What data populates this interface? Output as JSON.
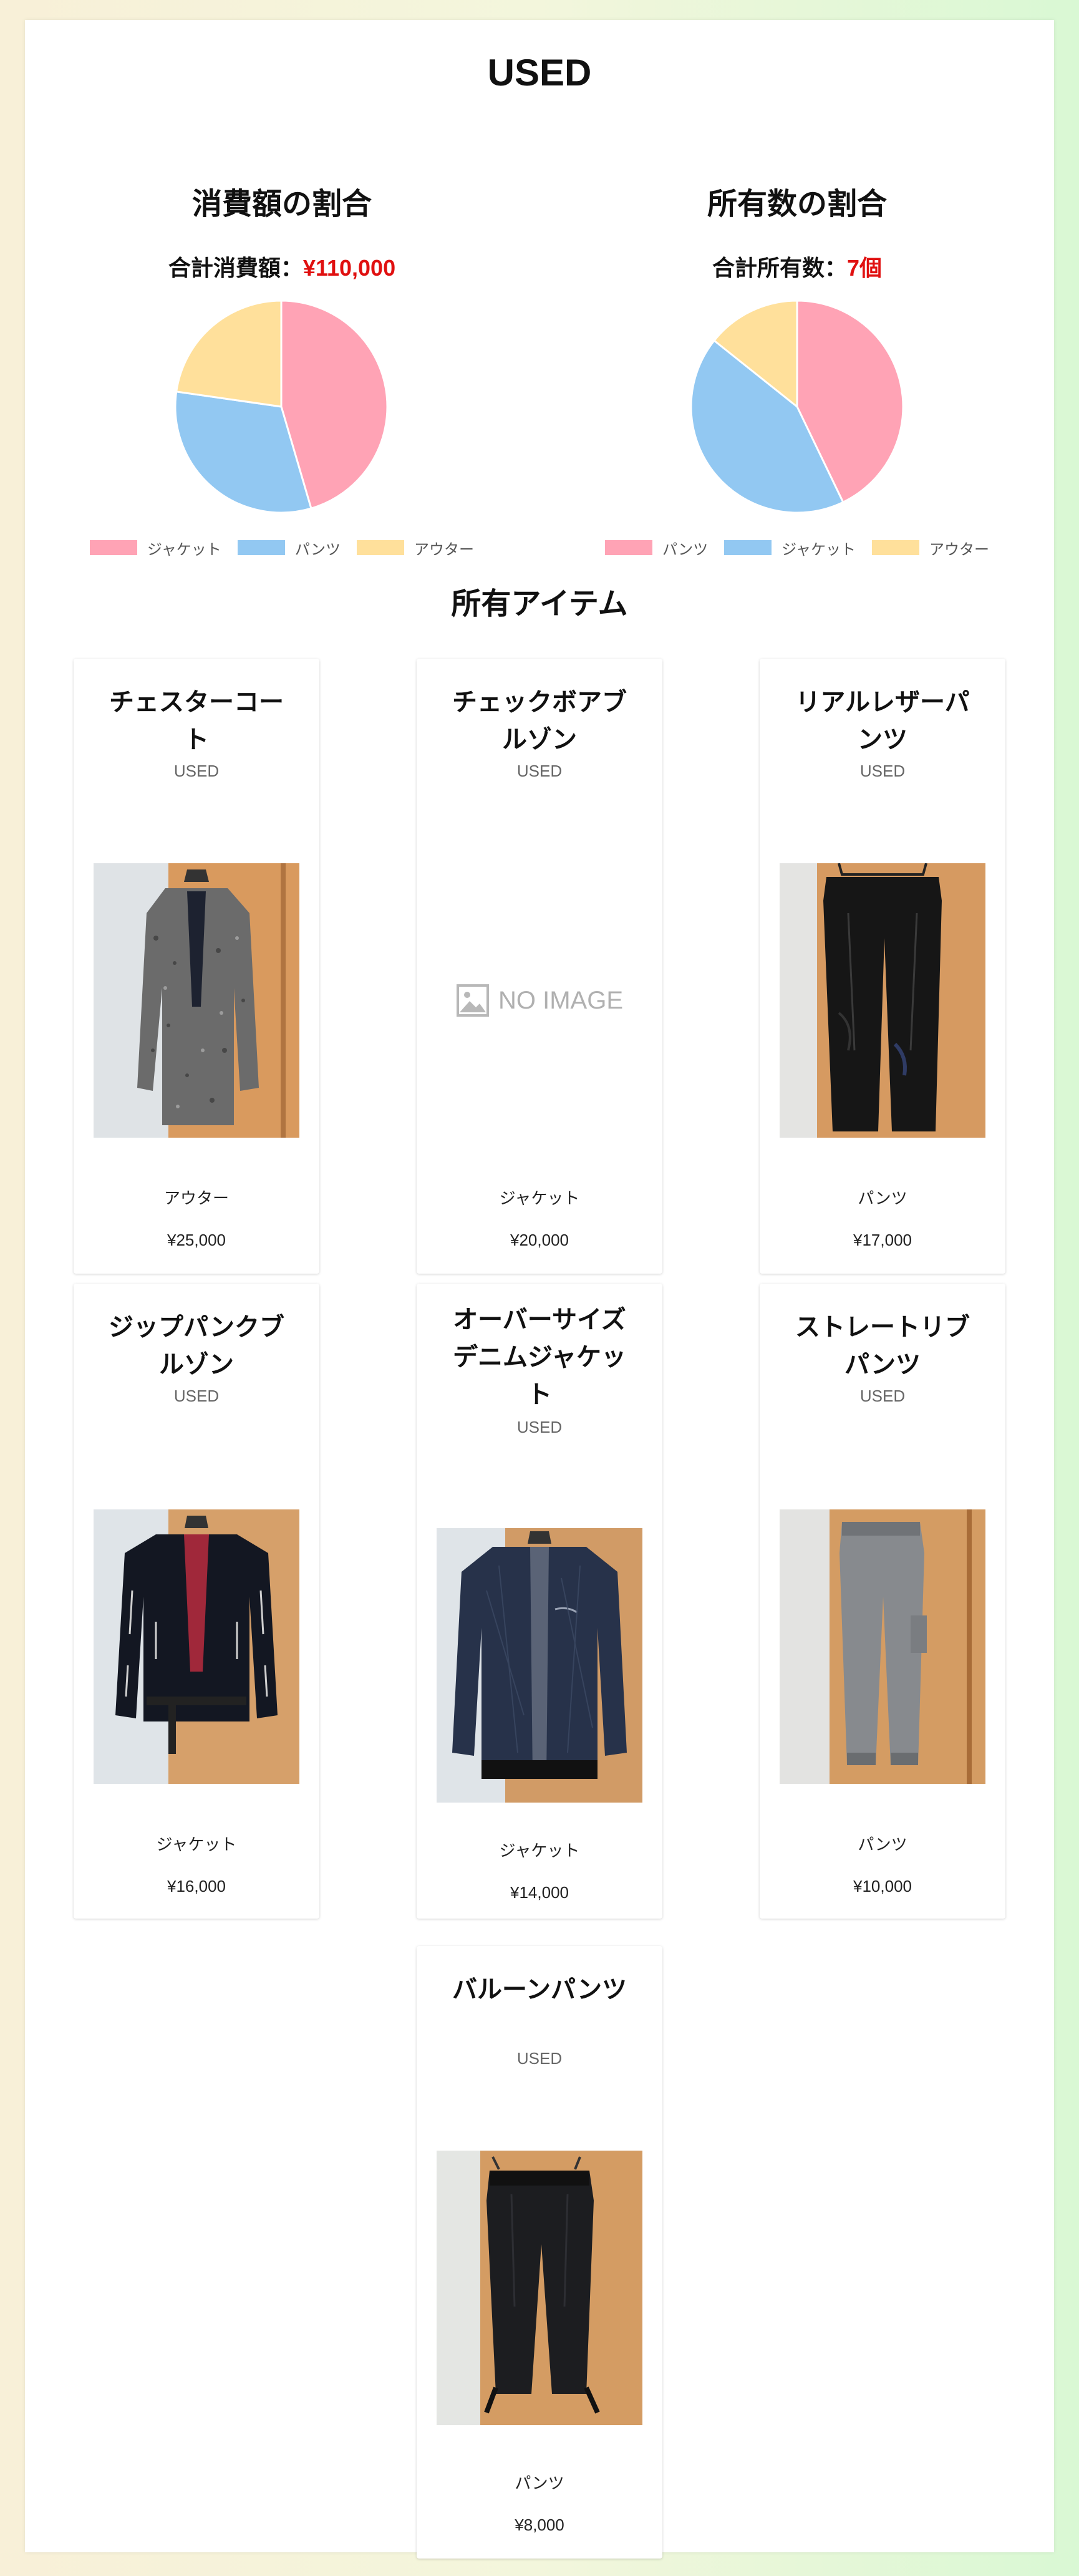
{
  "page": {
    "title": "USED"
  },
  "charts": [
    {
      "title": "消費額の割合",
      "total_label": "合計消費額：",
      "total_value": "¥110,000",
      "legend": [
        "ジャケット",
        "パンツ",
        "アウター"
      ]
    },
    {
      "title": "所有数の割合",
      "total_label": "合計所有数：",
      "total_value": "7個",
      "legend": [
        "パンツ",
        "ジャケット",
        "アウター"
      ]
    }
  ],
  "chart_data": [
    {
      "type": "pie",
      "categories": [
        "ジャケット",
        "パンツ",
        "アウター"
      ],
      "values": [
        50000,
        35000,
        25000
      ],
      "colors": [
        "#ffa3b5",
        "#92c8f2",
        "#ffe09b"
      ]
    },
    {
      "type": "pie",
      "categories": [
        "パンツ",
        "ジャケット",
        "アウター"
      ],
      "values": [
        3,
        3,
        1
      ],
      "colors": [
        "#ffa3b5",
        "#92c8f2",
        "#ffe09b"
      ]
    }
  ],
  "items_section": {
    "title": "所有アイテム"
  },
  "items": [
    {
      "name": "チェスターコート",
      "status": "USED",
      "category": "アウター",
      "price": "¥25,000",
      "image": "coat-grey"
    },
    {
      "name": "チェックボアブルゾン",
      "status": "USED",
      "category": "ジャケット",
      "price": "¥20,000",
      "image": "none"
    },
    {
      "name": "リアルレザーパンツ",
      "status": "USED",
      "category": "パンツ",
      "price": "¥17,000",
      "image": "leather-pants"
    },
    {
      "name": "ジップパンクブルゾン",
      "status": "USED",
      "category": "ジャケット",
      "price": "¥16,000",
      "image": "black-jacket"
    },
    {
      "name": "オーバーサイズデニムジャケット",
      "status": "USED",
      "category": "ジャケット",
      "price": "¥14,000",
      "image": "denim-jacket"
    },
    {
      "name": "ストレートリブパンツ",
      "status": "USED",
      "category": "パンツ",
      "price": "¥10,000",
      "image": "grey-pants"
    },
    {
      "name": "バルーンパンツ",
      "status": "USED",
      "category": "パンツ",
      "price": "¥8,000",
      "image": "black-pants"
    }
  ],
  "no_image_text": "NO IMAGE"
}
